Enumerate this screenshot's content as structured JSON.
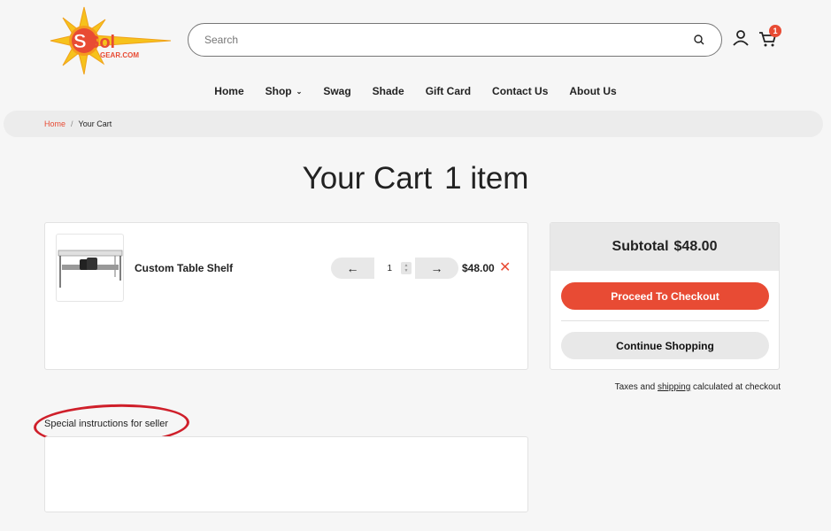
{
  "brand": {
    "logo_text": "Sol",
    "logo_subtext": "GEAR.COM"
  },
  "search": {
    "placeholder": "Search",
    "value": ""
  },
  "header": {
    "cart_count": "1"
  },
  "nav": {
    "items": [
      {
        "label": "Home"
      },
      {
        "label": "Shop",
        "has_dropdown": true
      },
      {
        "label": "Swag"
      },
      {
        "label": "Shade"
      },
      {
        "label": "Gift Card"
      },
      {
        "label": "Contact Us"
      },
      {
        "label": "About Us"
      }
    ]
  },
  "breadcrumb": {
    "home": "Home",
    "separator": "/",
    "current": "Your Cart"
  },
  "page": {
    "title": "Your Cart",
    "item_count": "1 item"
  },
  "cart": {
    "items": [
      {
        "name": "Custom Table Shelf",
        "quantity": "1",
        "price": "$48.00",
        "minus": "←",
        "plus": "→",
        "remove": "✕"
      }
    ]
  },
  "summary": {
    "subtotal_label": "Subtotal",
    "subtotal_value": "$48.00",
    "checkout_label": "Proceed To Checkout",
    "continue_label": "Continue Shopping",
    "taxes_prefix": "Taxes and",
    "taxes_link": "shipping",
    "taxes_suffix": "calculated at checkout"
  },
  "notes": {
    "label": "Special instructions for seller",
    "value": ""
  },
  "colors": {
    "accent": "#e84b34",
    "annotation": "#cf1f2a"
  }
}
